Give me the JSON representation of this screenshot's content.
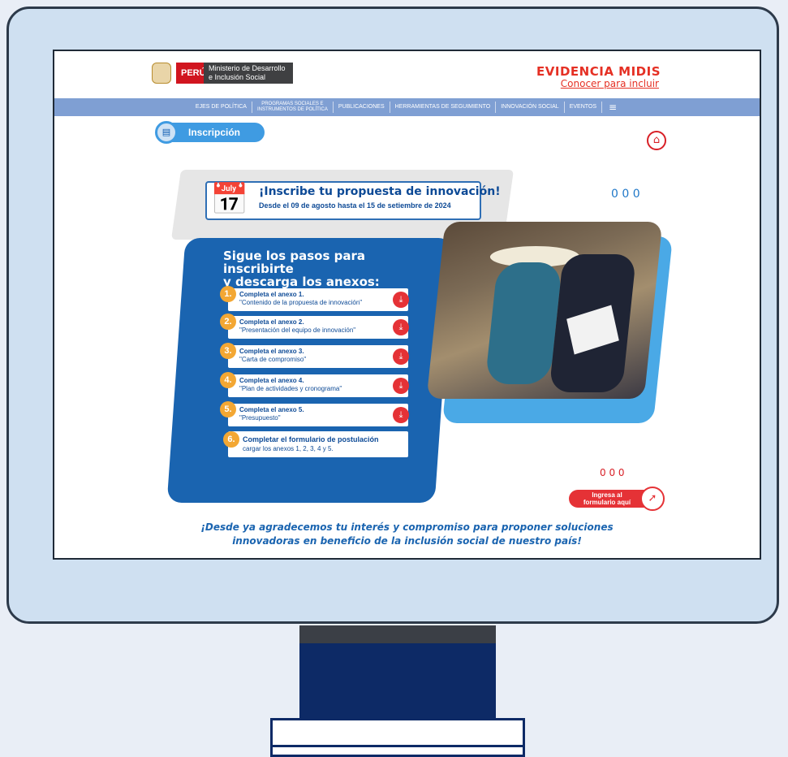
{
  "header": {
    "country": "PERÚ",
    "ministry_line1": "Ministerio de Desarrollo",
    "ministry_line2": "e Inclusión Social",
    "brand_title": "EVIDENCIA MIDIS",
    "brand_subtitle": "Conocer para incluir"
  },
  "nav": {
    "items": [
      {
        "label": "EJES DE POLÍTICA"
      },
      {
        "label_line1": "PROGRAMAS SOCIALES E",
        "label_line2": "INSTRUMENTOS DE POLÍTICA"
      },
      {
        "label": "PUBLICACIONES"
      },
      {
        "label": "HERRAMIENTAS DE SEGUIMIENTO"
      },
      {
        "label": "INNOVACIÓN SOCIAL"
      },
      {
        "label": "EVENTOS"
      }
    ],
    "menu_icon": "hamburger-menu-icon"
  },
  "page": {
    "section_label": "Inscripción",
    "home_icon": "home-icon",
    "banner_title": "¡Inscribe tu propuesta de innovación!",
    "banner_subtitle": "Desde el 09 de agosto hasta el 15 de setiembre de 2024",
    "steps_title_line1": "Sigue los pasos para inscribirte",
    "steps_title_line2": "y descarga los anexos:",
    "steps": [
      {
        "num": "1.",
        "title": "Completa el anexo 1.",
        "subtitle": "\"Contenido de la propuesta de innovación\""
      },
      {
        "num": "2.",
        "title": "Completa el anexo 2.",
        "subtitle": "\"Presentación del equipo de innovación\""
      },
      {
        "num": "3.",
        "title": "Completa el anexo 3.",
        "subtitle": "\"Carta de compromiso\""
      },
      {
        "num": "4.",
        "title": "Completa el anexo 4.",
        "subtitle": "\"Plan de actividades y cronograma\""
      },
      {
        "num": "5.",
        "title": "Completa el anexo 5.",
        "subtitle": "\"Presupuesto\""
      }
    ],
    "step6": {
      "num": "6.",
      "title": "Completar el formulario de postulación",
      "subtitle": "cargar los anexos 1, 2, 3, 4 y 5."
    },
    "cta_line1": "Ingresa al",
    "cta_line2": "formulario aquí",
    "footer_line1": "¡Desde ya agradecemos tu interés y compromiso para proponer soluciones",
    "footer_line2": "innovadoras en beneficio de la inclusión social de nuestro país!"
  },
  "colors": {
    "accent_red": "#e53024",
    "nav_blue": "#7f9fd3",
    "panel_blue": "#1a64b0",
    "step_orange": "#f3a733",
    "monitor_bg": "#cfe0f1",
    "stand_navy": "#0d2a66"
  }
}
